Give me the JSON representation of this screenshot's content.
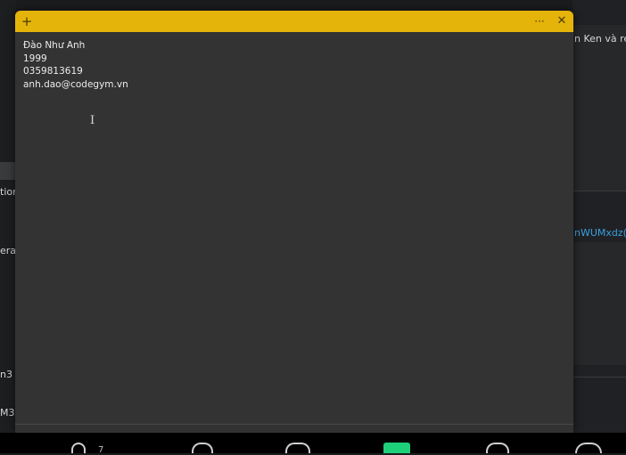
{
  "background": {
    "left_fragments": [
      "tion",
      "erat",
      "n3",
      "M3"
    ],
    "right_fragments": [
      "n Ken và re",
      "nWUMxdz("
    ],
    "link_color": "#3aa0e0"
  },
  "taskbar": {
    "badge_count": "7"
  },
  "note": {
    "header_color": "#e5b40a",
    "new_note_icon": "plus-icon",
    "menu_icon": "more-icon",
    "close_icon": "close-icon",
    "lines": [
      "Đào Như Anh",
      "1999",
      "0359813619",
      "anh.dao@codegym.vn"
    ]
  }
}
